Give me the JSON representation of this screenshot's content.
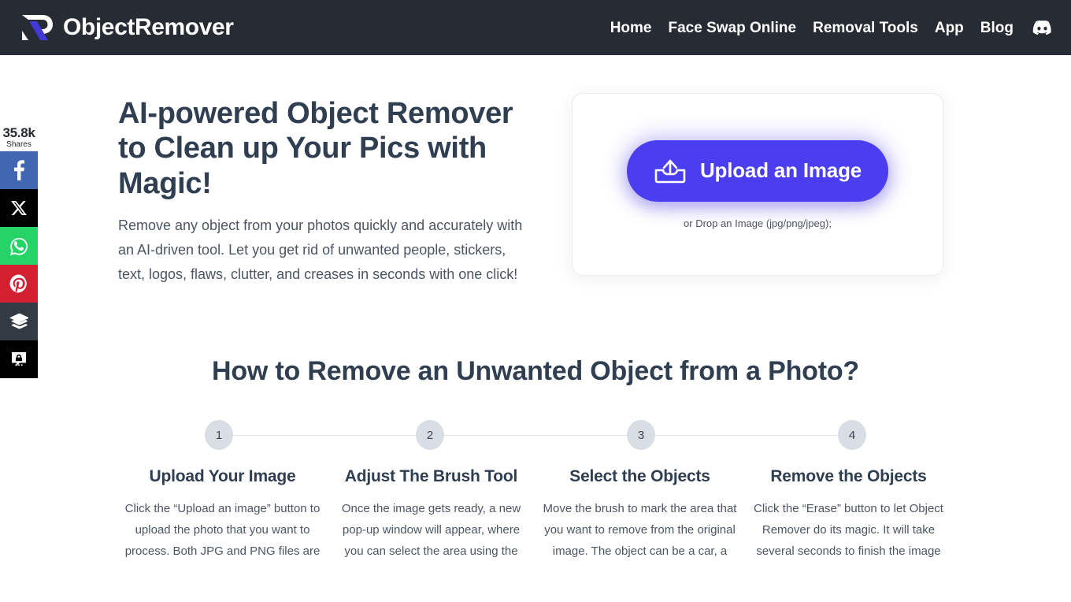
{
  "header": {
    "brand_name": "ObjectRemover",
    "logo_icon": "objectremover-r-logo",
    "nav": [
      {
        "label": "Home",
        "name": "nav-home"
      },
      {
        "label": "Face Swap Online",
        "name": "nav-face-swap-online"
      },
      {
        "label": "Removal Tools",
        "name": "nav-removal-tools"
      },
      {
        "label": "App",
        "name": "nav-app"
      },
      {
        "label": "Blog",
        "name": "nav-blog"
      }
    ],
    "discord_icon": "discord-icon",
    "background_color": "#272c34"
  },
  "social_bar": {
    "count": "35.8k",
    "count_label": "Shares",
    "buttons": [
      {
        "name": "share-facebook",
        "icon": "facebook-icon",
        "color": "#4267b2"
      },
      {
        "name": "share-x-twitter",
        "icon": "x-twitter-icon",
        "color": "#000000"
      },
      {
        "name": "share-whatsapp",
        "icon": "whatsapp-icon",
        "color": "#25d366"
      },
      {
        "name": "share-pinterest",
        "icon": "pinterest-icon",
        "color": "#d32030"
      },
      {
        "name": "share-buffer",
        "icon": "buffer-icon",
        "color": "#323b43"
      },
      {
        "name": "share-more",
        "icon": "share-more-icon",
        "color": "#000000"
      }
    ]
  },
  "hero": {
    "title": "AI-powered Object Remover to Clean up Your Pics with Magic!",
    "subtitle": "Remove any object from your photos quickly and accurately with an AI-driven tool. Let you get rid of unwanted people, stickers, text, logos, flaws, clutter, and creases in seconds with one click!",
    "upload": {
      "button_label": "Upload an Image",
      "button_icon": "upload-tray-icon",
      "button_color": "#4b3df0",
      "drop_hint": "or Drop an Image (jpg/png/jpeg);"
    }
  },
  "howto": {
    "title": "How to Remove an Unwanted Object from a Photo?",
    "steps": [
      {
        "number": "1",
        "title": "Upload Your Image",
        "text": "Click the “Upload an image” button to upload the photo that you want to process. Both JPG and PNG files are"
      },
      {
        "number": "2",
        "title": "Adjust The Brush Tool",
        "text": "Once the image gets ready, a new pop-up window will appear, where you can select the area using the"
      },
      {
        "number": "3",
        "title": "Select the Objects",
        "text": "Move the brush to mark the area that you want to remove from the original image. The object can be a car, a"
      },
      {
        "number": "4",
        "title": "Remove the Objects",
        "text": "Click the “Erase” button to let Object Remover do its magic. It will take several seconds to finish the image"
      }
    ]
  }
}
